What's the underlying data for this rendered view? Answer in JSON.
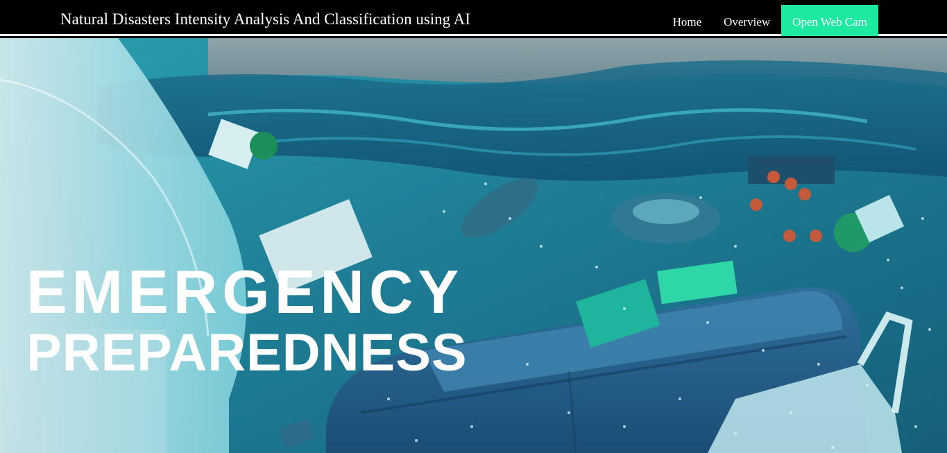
{
  "navbar": {
    "brand": "Natural Disasters Intensity Analysis And Classification using AI",
    "links": [
      {
        "label": "Home"
      },
      {
        "label": "Overview"
      }
    ],
    "cta_label": "Open Web Cam",
    "cta_color": "#1de9a0"
  },
  "hero": {
    "line1": "EMERGENCY",
    "line2": "PREPAREDNESS",
    "image": "flooded-room-illustration"
  }
}
